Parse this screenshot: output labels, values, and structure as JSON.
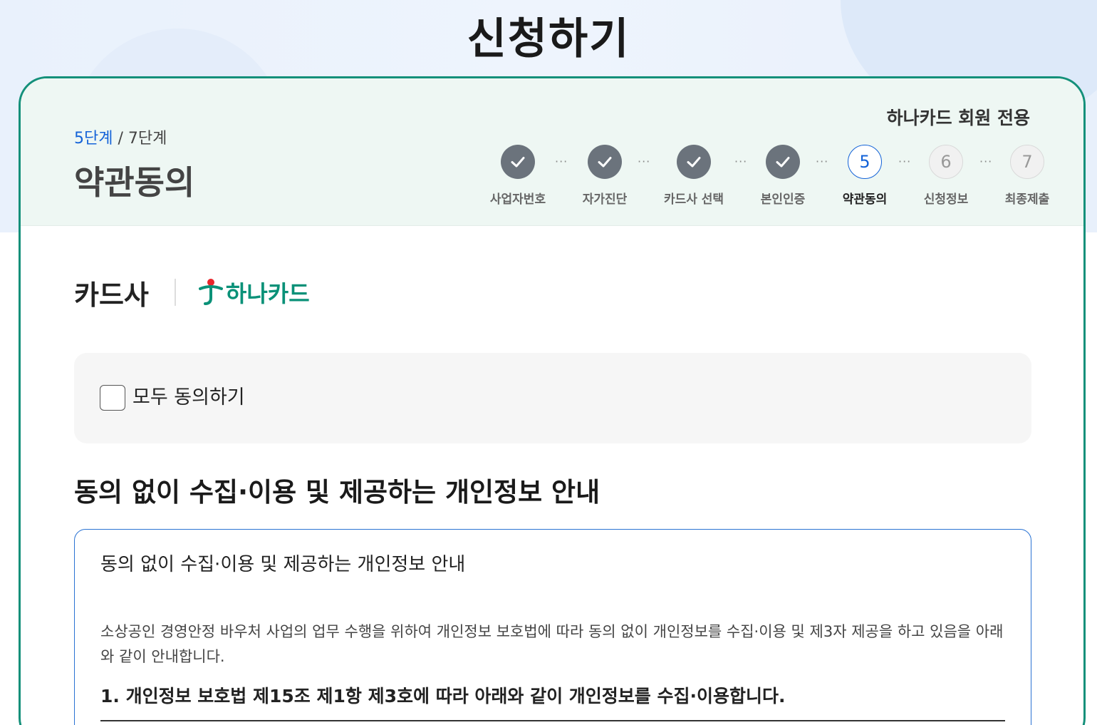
{
  "page": {
    "title": "신청하기"
  },
  "header": {
    "step_current": "5단계",
    "step_total": " / 7단계",
    "step_title": "약관동의",
    "member_only": "하나카드 회원 전용"
  },
  "steps": [
    {
      "label": "사업자번호",
      "state": "done",
      "icon": "check-icon"
    },
    {
      "label": "자가진단",
      "state": "done",
      "icon": "check-icon"
    },
    {
      "label": "카드사 선택",
      "state": "done",
      "icon": "check-icon"
    },
    {
      "label": "본인인증",
      "state": "done",
      "icon": "check-icon"
    },
    {
      "label": "약관동의",
      "state": "current",
      "number": "5"
    },
    {
      "label": "신청정보",
      "state": "todo",
      "number": "6"
    },
    {
      "label": "최종제출",
      "state": "todo",
      "number": "7"
    }
  ],
  "step_separator": "···",
  "company": {
    "label": "카드사",
    "name": "하나카드",
    "brand_color": "#0a9178"
  },
  "agree_all": {
    "label": "모두 동의하기",
    "checked": false
  },
  "section": {
    "title": "동의 없이 수집·이용 및 제공하는 개인정보 안내"
  },
  "notice": {
    "title": "동의 없이 수집·이용 및 제공하는 개인정보 안내",
    "body": "소상공인 경영안정 바우처 사업의 업무 수행을 위하여 개인정보 보호법에 따라 동의 없이 개인정보를 수집·이용 및 제3자 제공을 하고 있음을 아래와 같이 안내합니다.",
    "subheading": "1. 개인정보 보호법 제15조 제1항 제3호에 따라 아래와 같이 개인정보를 수집·이용합니다."
  },
  "colors": {
    "accent_green": "#14907a",
    "accent_blue": "#1463d8",
    "header_bg": "#eef7f3"
  }
}
